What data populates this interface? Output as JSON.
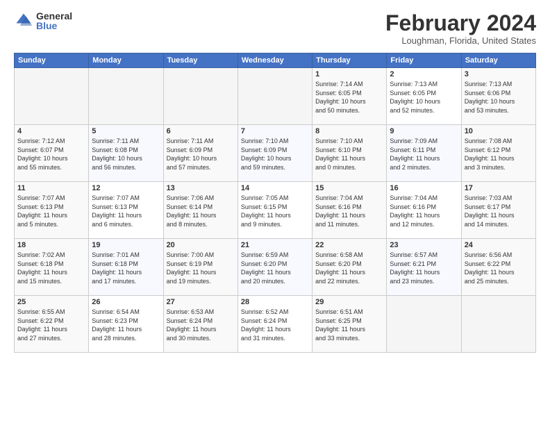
{
  "logo": {
    "general": "General",
    "blue": "Blue"
  },
  "title": "February 2024",
  "location": "Loughman, Florida, United States",
  "headers": [
    "Sunday",
    "Monday",
    "Tuesday",
    "Wednesday",
    "Thursday",
    "Friday",
    "Saturday"
  ],
  "weeks": [
    [
      {
        "day": "",
        "info": ""
      },
      {
        "day": "",
        "info": ""
      },
      {
        "day": "",
        "info": ""
      },
      {
        "day": "",
        "info": ""
      },
      {
        "day": "1",
        "info": "Sunrise: 7:14 AM\nSunset: 6:05 PM\nDaylight: 10 hours\nand 50 minutes."
      },
      {
        "day": "2",
        "info": "Sunrise: 7:13 AM\nSunset: 6:05 PM\nDaylight: 10 hours\nand 52 minutes."
      },
      {
        "day": "3",
        "info": "Sunrise: 7:13 AM\nSunset: 6:06 PM\nDaylight: 10 hours\nand 53 minutes."
      }
    ],
    [
      {
        "day": "4",
        "info": "Sunrise: 7:12 AM\nSunset: 6:07 PM\nDaylight: 10 hours\nand 55 minutes."
      },
      {
        "day": "5",
        "info": "Sunrise: 7:11 AM\nSunset: 6:08 PM\nDaylight: 10 hours\nand 56 minutes."
      },
      {
        "day": "6",
        "info": "Sunrise: 7:11 AM\nSunset: 6:09 PM\nDaylight: 10 hours\nand 57 minutes."
      },
      {
        "day": "7",
        "info": "Sunrise: 7:10 AM\nSunset: 6:09 PM\nDaylight: 10 hours\nand 59 minutes."
      },
      {
        "day": "8",
        "info": "Sunrise: 7:10 AM\nSunset: 6:10 PM\nDaylight: 11 hours\nand 0 minutes."
      },
      {
        "day": "9",
        "info": "Sunrise: 7:09 AM\nSunset: 6:11 PM\nDaylight: 11 hours\nand 2 minutes."
      },
      {
        "day": "10",
        "info": "Sunrise: 7:08 AM\nSunset: 6:12 PM\nDaylight: 11 hours\nand 3 minutes."
      }
    ],
    [
      {
        "day": "11",
        "info": "Sunrise: 7:07 AM\nSunset: 6:13 PM\nDaylight: 11 hours\nand 5 minutes."
      },
      {
        "day": "12",
        "info": "Sunrise: 7:07 AM\nSunset: 6:13 PM\nDaylight: 11 hours\nand 6 minutes."
      },
      {
        "day": "13",
        "info": "Sunrise: 7:06 AM\nSunset: 6:14 PM\nDaylight: 11 hours\nand 8 minutes."
      },
      {
        "day": "14",
        "info": "Sunrise: 7:05 AM\nSunset: 6:15 PM\nDaylight: 11 hours\nand 9 minutes."
      },
      {
        "day": "15",
        "info": "Sunrise: 7:04 AM\nSunset: 6:16 PM\nDaylight: 11 hours\nand 11 minutes."
      },
      {
        "day": "16",
        "info": "Sunrise: 7:04 AM\nSunset: 6:16 PM\nDaylight: 11 hours\nand 12 minutes."
      },
      {
        "day": "17",
        "info": "Sunrise: 7:03 AM\nSunset: 6:17 PM\nDaylight: 11 hours\nand 14 minutes."
      }
    ],
    [
      {
        "day": "18",
        "info": "Sunrise: 7:02 AM\nSunset: 6:18 PM\nDaylight: 11 hours\nand 15 minutes."
      },
      {
        "day": "19",
        "info": "Sunrise: 7:01 AM\nSunset: 6:18 PM\nDaylight: 11 hours\nand 17 minutes."
      },
      {
        "day": "20",
        "info": "Sunrise: 7:00 AM\nSunset: 6:19 PM\nDaylight: 11 hours\nand 19 minutes."
      },
      {
        "day": "21",
        "info": "Sunrise: 6:59 AM\nSunset: 6:20 PM\nDaylight: 11 hours\nand 20 minutes."
      },
      {
        "day": "22",
        "info": "Sunrise: 6:58 AM\nSunset: 6:20 PM\nDaylight: 11 hours\nand 22 minutes."
      },
      {
        "day": "23",
        "info": "Sunrise: 6:57 AM\nSunset: 6:21 PM\nDaylight: 11 hours\nand 23 minutes."
      },
      {
        "day": "24",
        "info": "Sunrise: 6:56 AM\nSunset: 6:22 PM\nDaylight: 11 hours\nand 25 minutes."
      }
    ],
    [
      {
        "day": "25",
        "info": "Sunrise: 6:55 AM\nSunset: 6:22 PM\nDaylight: 11 hours\nand 27 minutes."
      },
      {
        "day": "26",
        "info": "Sunrise: 6:54 AM\nSunset: 6:23 PM\nDaylight: 11 hours\nand 28 minutes."
      },
      {
        "day": "27",
        "info": "Sunrise: 6:53 AM\nSunset: 6:24 PM\nDaylight: 11 hours\nand 30 minutes."
      },
      {
        "day": "28",
        "info": "Sunrise: 6:52 AM\nSunset: 6:24 PM\nDaylight: 11 hours\nand 31 minutes."
      },
      {
        "day": "29",
        "info": "Sunrise: 6:51 AM\nSunset: 6:25 PM\nDaylight: 11 hours\nand 33 minutes."
      },
      {
        "day": "",
        "info": ""
      },
      {
        "day": "",
        "info": ""
      }
    ]
  ]
}
